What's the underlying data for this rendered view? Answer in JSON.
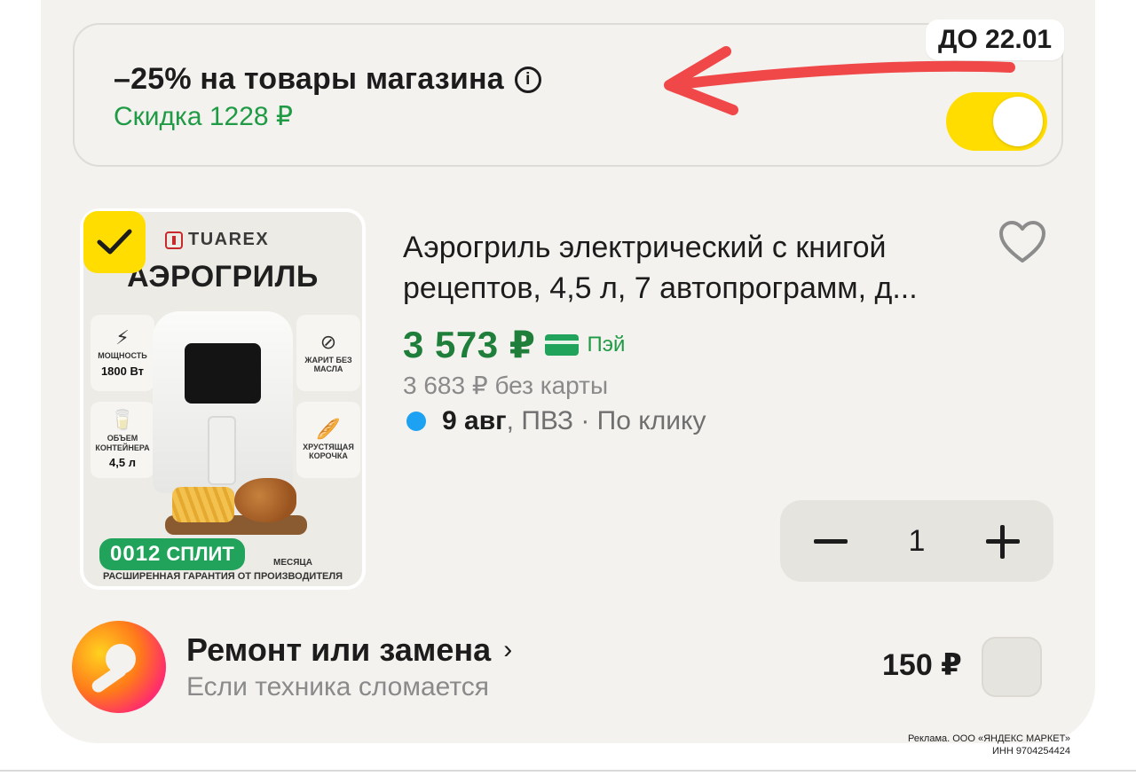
{
  "promo": {
    "title": "–25% на товары магазина",
    "info_icon": "info-icon",
    "discount": "Скидка 1228 ₽",
    "deadline": "ДО 22.01",
    "toggle_on": true,
    "accent_color": "#ffdd00"
  },
  "product": {
    "selected": true,
    "image": {
      "brand": "TUAREX",
      "title": "АЭРОГРИЛЬ",
      "features": {
        "power_label": "МОЩНОСТЬ",
        "power_value": "1800 Вт",
        "no_oil_label": "ЖАРИТ БЕЗ МАСЛА",
        "volume_label": "ОБЪЕМ КОНТЕЙНЕРА",
        "volume_value": "4,5 л",
        "crust_label": "ХРУСТЯЩАЯ КОРОЧКА"
      },
      "split_digits": "0012",
      "split_word": "СПЛИТ",
      "footer_line1": "МЕСЯЦА",
      "footer_line2": "РАСШИРЕННАЯ ГАРАНТИЯ ОТ ПРОИЗВОДИТЕЛЯ"
    },
    "name": "Аэрогриль электрический с книгой рецептов, 4,5 л, 7 автопрограмм, д...",
    "price": "3 573 ₽",
    "pay_label": "Пэй",
    "price_without_card": "3 683 ₽ без карты",
    "delivery_date": "9 авг",
    "delivery_rest": ", ПВЗ · По клику",
    "quantity": "1",
    "price_color": "#1f7e3a"
  },
  "service": {
    "title": "Ремонт или замена",
    "chevron": "›",
    "subtitle": "Если техника сломается",
    "price": "150 ₽",
    "checked": false
  },
  "legal": {
    "line1": "Реклама. ООО «ЯНДЕКС МАРКЕТ»",
    "line2": "ИНН 9704254424"
  }
}
